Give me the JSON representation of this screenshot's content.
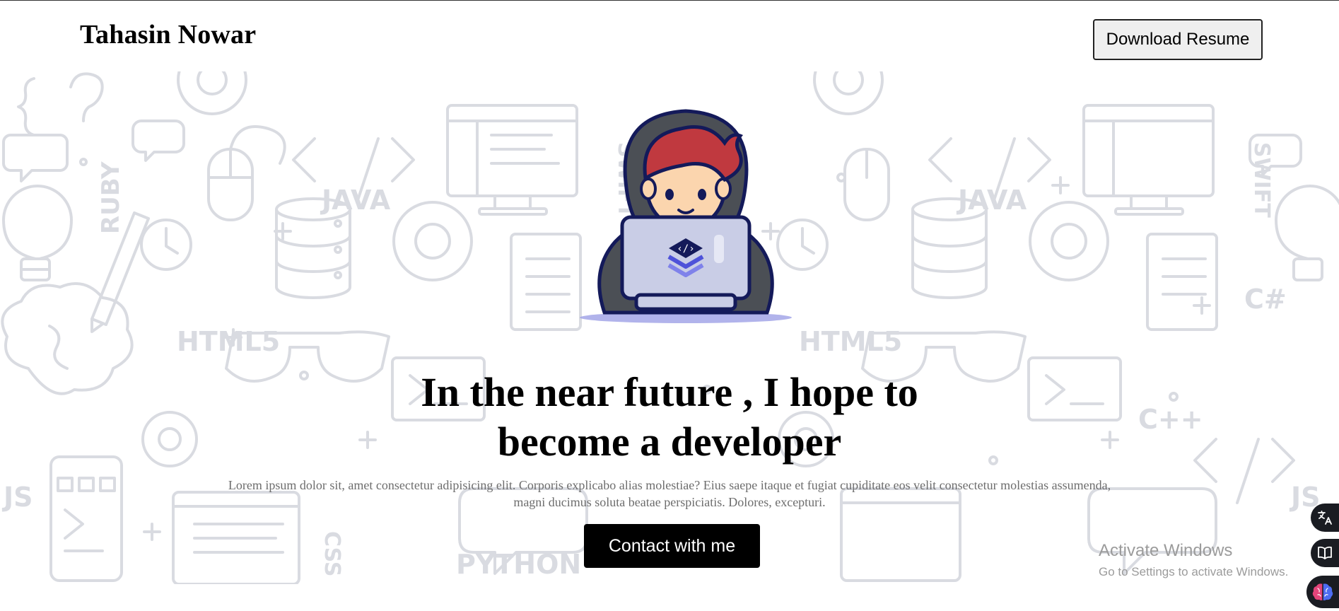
{
  "navbar": {
    "brand": "Tahasin Nowar",
    "resume_button": "Download Resume"
  },
  "hero": {
    "headline_line1": "In the near future , I hope to",
    "headline_line2": "become a developer",
    "description": "Lorem ipsum dolor sit, amet consectetur adipisicing elit. Corporis explicabo alias molestiae? Eius saepe itaque et fugiat cupiditate eos velit consectetur molestias assumenda, magni ducimus soluta beatae perspiciatis. Dolores, excepturi.",
    "contact_button": "Contact with me",
    "illustration_icon": "developer-with-laptop-icon",
    "pattern_labels": {
      "java": "JAVA",
      "ruby": "RUBY",
      "html": "HTML5",
      "swift": "SWIFT",
      "css": "CSS",
      "js": "JS",
      "python": "PYTHON",
      "csharp": "C#",
      "cpp": "C++"
    }
  },
  "watermark": {
    "title": "Activate Windows",
    "subtitle": "Go to Settings to activate Windows."
  },
  "side_widgets": [
    {
      "icon": "translate-icon"
    },
    {
      "icon": "reader-book-icon"
    },
    {
      "icon": "brain-icon"
    }
  ],
  "colors": {
    "background": "#ffffff",
    "pattern": "#d9dbe1",
    "button_dark": "#000000",
    "button_light": "#efefef",
    "description_text": "#6d6d6d",
    "watermark_text": "#9b9b9b",
    "hood": "#4b4f55",
    "hair": "#c0393f",
    "laptop": "#c9cde6",
    "outline": "#141a5a",
    "accent_blue": "#4e52d9"
  }
}
